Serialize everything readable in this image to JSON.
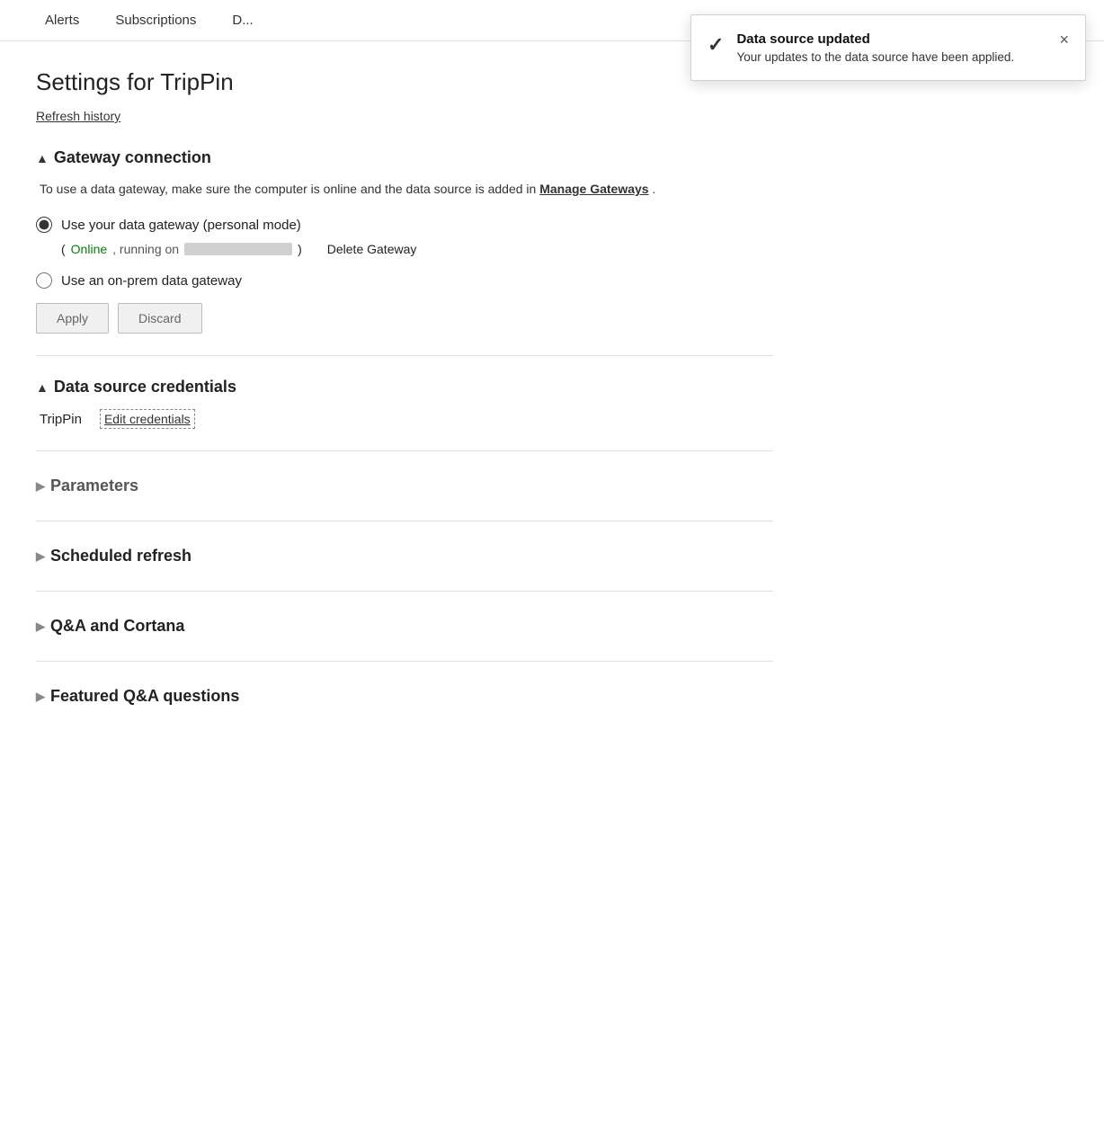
{
  "tabs": [
    {
      "id": "alerts",
      "label": "Alerts",
      "active": false
    },
    {
      "id": "subscriptions",
      "label": "Subscriptions",
      "active": false
    },
    {
      "id": "more",
      "label": "D...",
      "active": false
    }
  ],
  "page": {
    "title": "Settings for TripPin",
    "refresh_history_label": "Refresh history"
  },
  "toast": {
    "title": "Data source updated",
    "message": "Your updates to the data source have been applied.",
    "close_label": "×"
  },
  "gateway_section": {
    "header": "Gateway connection",
    "description_part1": "To use a data gateway, make sure the computer is online and the data source is added in",
    "manage_gateways_label": "Manage Gateways",
    "description_part2": ".",
    "radio_personal": "Use your data gateway (personal mode)",
    "status_open": "(",
    "status_online": "Online",
    "status_running": ", running on",
    "status_close": ")",
    "delete_gateway_label": "Delete Gateway",
    "radio_onprem": "Use an on-prem data gateway",
    "apply_label": "Apply",
    "discard_label": "Discard"
  },
  "credentials_section": {
    "header": "Data source credentials",
    "datasource_name": "TripPin",
    "edit_label": "Edit credentials"
  },
  "parameters_section": {
    "header": "Parameters"
  },
  "scheduled_refresh_section": {
    "header": "Scheduled refresh"
  },
  "qa_section": {
    "header": "Q&A and Cortana"
  },
  "featured_qa_section": {
    "header": "Featured Q&A questions"
  }
}
